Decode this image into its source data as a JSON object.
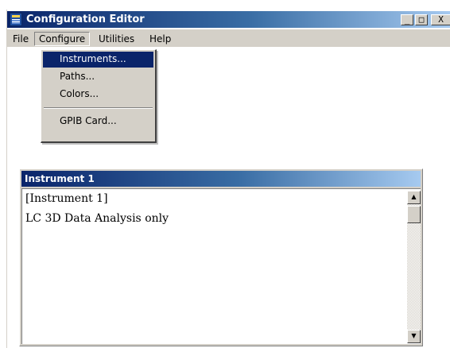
{
  "window": {
    "title": "Configuration Editor",
    "icon": "app-icon",
    "controls": {
      "minimize": "_",
      "maximize": "□",
      "close": "X"
    }
  },
  "menubar": {
    "items": [
      {
        "label": "File"
      },
      {
        "label": "Configure",
        "active": true
      },
      {
        "label": "Utilities"
      },
      {
        "label": "Help"
      }
    ]
  },
  "configure_menu": {
    "items": [
      {
        "label": "Instruments...",
        "selected": true
      },
      {
        "label": "Paths..."
      },
      {
        "label": "Colors..."
      },
      {
        "label": "GPIB Card..."
      }
    ]
  },
  "child_window": {
    "title": "Instrument 1",
    "lines": [
      "[Instrument 1]",
      "LC 3D Data Analysis only"
    ]
  },
  "scrollbar": {
    "up_arrow": "▲",
    "down_arrow": "▼"
  },
  "colors": {
    "title_active": "#0a246a",
    "title_gradient_end": "#a6caf0",
    "face": "#d4d0c8",
    "selection": "#0a246a"
  }
}
